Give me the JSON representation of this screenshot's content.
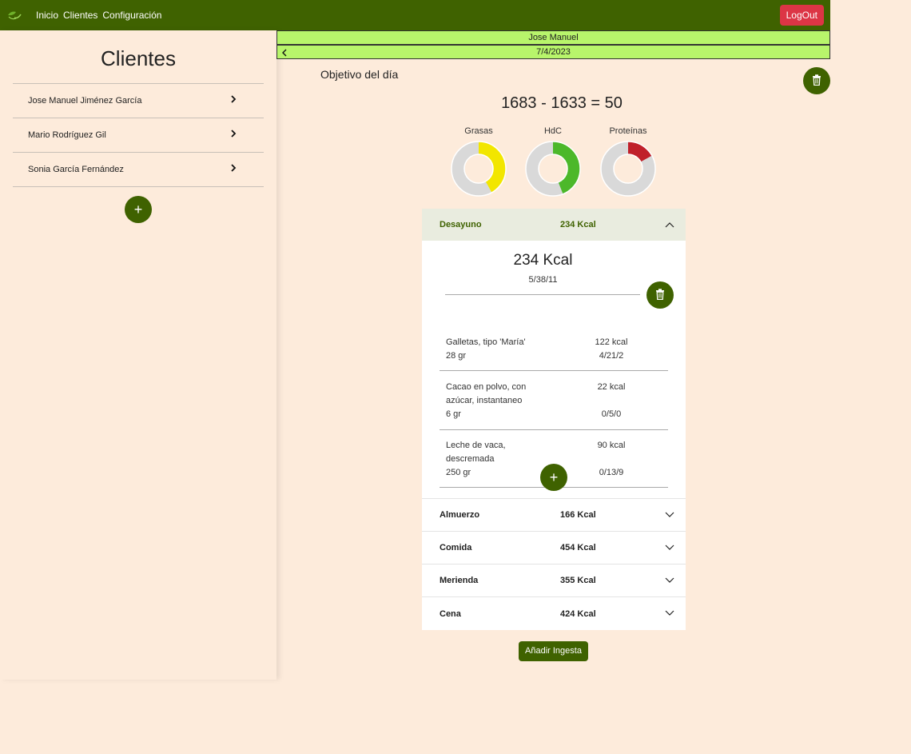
{
  "nav": {
    "links": [
      "Inicio",
      "Clientes",
      "Configuración"
    ],
    "logout": "LogOut"
  },
  "sidebar": {
    "title": "Clientes",
    "clients": [
      "Jose Manuel Jiménez García",
      "Mario Rodríguez Gil",
      "Sonia García Fernández"
    ],
    "add_label": "+"
  },
  "header": {
    "client_name": "Jose Manuel",
    "date": "7/4/2023"
  },
  "day": {
    "objetivo_label": "Objetivo del día",
    "target": "1683",
    "minus": "-",
    "consumed": "1633",
    "equals": "=",
    "remaining": "50"
  },
  "macros": [
    {
      "label": "Grasas",
      "fraction": 0.42,
      "color": "#f2e600"
    },
    {
      "label": "HdC",
      "fraction": 0.44,
      "color": "#4cb82a"
    },
    {
      "label": "Proteínas",
      "fraction": 0.17,
      "color": "#c0202a"
    }
  ],
  "meals": [
    {
      "name": "Desayuno",
      "kcal": "234 Kcal",
      "expanded": true
    },
    {
      "name": "Almuerzo",
      "kcal": "166 Kcal",
      "expanded": false
    },
    {
      "name": "Comida",
      "kcal": "454 Kcal",
      "expanded": false
    },
    {
      "name": "Merienda",
      "kcal": "355 Kcal",
      "expanded": false
    },
    {
      "name": "Cena",
      "kcal": "424 Kcal",
      "expanded": false
    }
  ],
  "breakfast_detail": {
    "kcal": "234 Kcal",
    "macros": "5/38/11",
    "foods": [
      {
        "name": "Galletas, tipo 'María'",
        "qty": "28 gr",
        "kcal": "122 kcal",
        "macros": "4/21/2"
      },
      {
        "name": "Cacao en polvo, con azúcar, instantaneo",
        "qty": "6 gr",
        "kcal": "22 kcal",
        "macros": "0/5/0"
      },
      {
        "name": "Leche de vaca, descremada",
        "qty": "250 gr",
        "kcal": "90 kcal",
        "macros": "0/13/9"
      }
    ],
    "add_label": "+"
  },
  "actions": {
    "add_ingesta": "Añadir Ingesta"
  },
  "colors": {
    "brand": "#3f6200",
    "header_highlight": "#b8f56b",
    "logout": "#dc3545",
    "background": "#fdebdb",
    "donut_track": "#d9d9d9"
  }
}
